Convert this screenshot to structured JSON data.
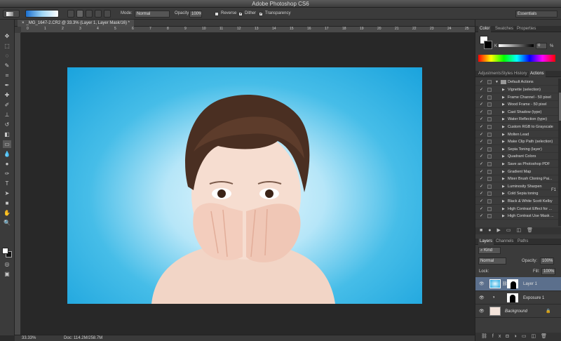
{
  "app": {
    "title": "Adobe Photoshop CS6"
  },
  "options": {
    "mode_label": "Mode:",
    "mode_value": "Normal",
    "opacity_label": "Opacity:",
    "opacity_value": "100%",
    "reverse_label": "Reverse",
    "dither_label": "Dither",
    "transparency_label": "Transparency",
    "workspace": "Essentials"
  },
  "document": {
    "tab_title": "_MG_1647-2.CR2 @ 33.3% (Layer 1, Layer Mask/16) *",
    "zoom": "33.33%",
    "doc_size": "Doc: 114.2M/258.7M"
  },
  "ruler": {
    "top_ticks": [
      "0",
      "1",
      "2",
      "3",
      "4",
      "5",
      "6",
      "7",
      "8",
      "9",
      "10",
      "11",
      "12",
      "13",
      "14",
      "15",
      "16",
      "17",
      "18",
      "19",
      "20",
      "21",
      "22",
      "23",
      "24",
      "25"
    ]
  },
  "color_panel": {
    "tabs": [
      "Color",
      "Swatches",
      "Properties"
    ],
    "channel_label": "K",
    "value": "0",
    "unit": "%"
  },
  "actions_panel": {
    "tabs": [
      "Adjustments",
      "Styles",
      "History",
      "Actions"
    ],
    "set_name": "Default Actions",
    "items": [
      "Vignette (selection)",
      "Frame Channel - 50 pixel",
      "Wood Frame - 50 pixel",
      "Cast Shadow (type)",
      "Water Reflection (type)",
      "Custom RGB to Grayscale",
      "Molten Lead",
      "Make Clip Path (selection)",
      "Sepia Toning (layer)",
      "Quadrant Colors",
      "Save as Photoshop PDF",
      "Gradient Map",
      "Mixer Brush Cloning Pai...",
      "Luminosity Sharpen",
      "Cold Sepia toning",
      "Black & White Scott Kelby",
      "High Contrast Effect for ...",
      "High Contrast Use Mask ..."
    ],
    "luminosity_shortcut": "F1"
  },
  "layers_panel": {
    "tabs": [
      "Layers",
      "Channels",
      "Paths"
    ],
    "filter_label": "Kind",
    "blend_mode": "Normal",
    "opacity_label": "Opacity:",
    "opacity_value": "100%",
    "lock_label": "Lock:",
    "fill_label": "Fill:",
    "fill_value": "100%",
    "layers": [
      "Layer 1",
      "Exposure 1",
      "Background"
    ]
  },
  "colors": {
    "ui_bg": "#3b3b3b",
    "canvas_bg": "#282828",
    "photo_bg": "#1aa3dd",
    "selected_row": "#5b6f8c"
  }
}
